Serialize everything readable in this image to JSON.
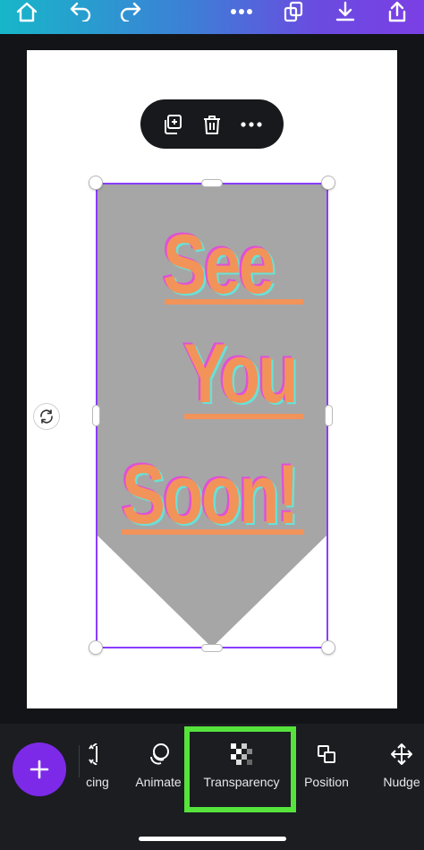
{
  "topbar": {
    "gradient_colors": [
      "#17b6c9",
      "#3d7fd6",
      "#6a4be0",
      "#7b3fe4"
    ],
    "icons": [
      "home-icon",
      "undo-icon",
      "redo-icon",
      "more-icon",
      "pages-icon",
      "download-icon",
      "share-icon"
    ]
  },
  "context_menu": {
    "icons": [
      "duplicate-icon",
      "trash-icon",
      "more-icon"
    ]
  },
  "design": {
    "banner_color": "#a6a6a6",
    "text_color": "#f2935a",
    "shadow_pink": "#e050d8",
    "shadow_cyan": "#67e2d8",
    "lines": [
      "See",
      "You",
      "Soon!"
    ]
  },
  "toolbar": {
    "add_icon": "plus-icon",
    "accent": "#7d2ae8",
    "highlight_color": "#55e33c",
    "items": [
      {
        "label": "cing",
        "icon": "spacing-icon"
      },
      {
        "label": "Animate",
        "icon": "animate-icon"
      },
      {
        "label": "Transparency",
        "icon": "transparency-icon"
      },
      {
        "label": "Position",
        "icon": "position-icon"
      },
      {
        "label": "Nudge",
        "icon": "nudge-icon"
      }
    ]
  }
}
